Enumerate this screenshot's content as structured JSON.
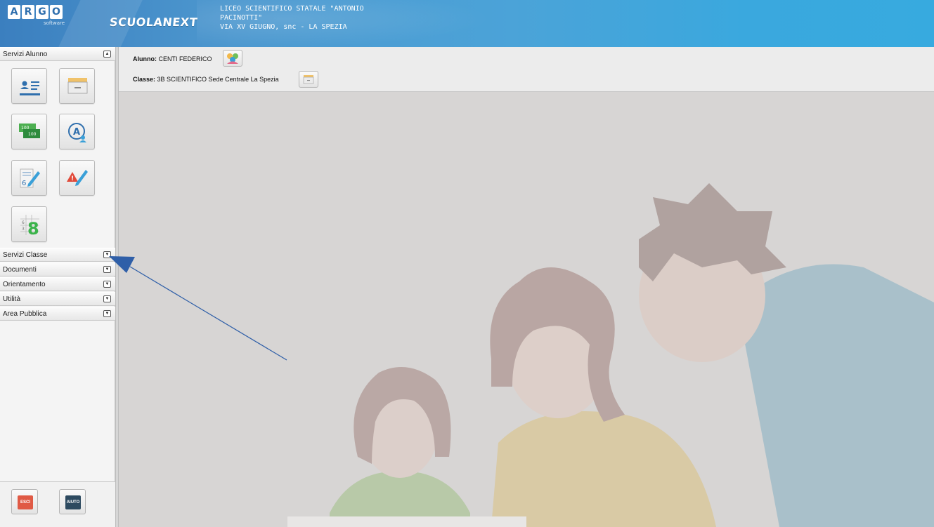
{
  "header": {
    "logo_letters": [
      "A",
      "R",
      "G",
      "O"
    ],
    "logo_sub": "software",
    "brand": "SCUOLANEXT",
    "school_line1": "LICEO SCIENTIFICO STATALE \"ANTONIO",
    "school_line2": "PACINOTTI\"",
    "school_line3": "VIA XV GIUGNO, snc - LA SPEZIA"
  },
  "sidebar": {
    "sections": [
      {
        "label": "Servizi Alunno",
        "state": "expanded"
      },
      {
        "label": "Servizi Classe",
        "state": "collapsed"
      },
      {
        "label": "Documenti",
        "state": "collapsed"
      },
      {
        "label": "Orientamento",
        "state": "collapsed"
      },
      {
        "label": "Utilità",
        "state": "collapsed"
      },
      {
        "label": "Area Pubblica",
        "state": "collapsed"
      }
    ],
    "student_icons": [
      {
        "icon": "student-card-icon"
      },
      {
        "icon": "archive-drawer-icon"
      },
      {
        "icon": "money-tax-icon"
      },
      {
        "icon": "absence-user-icon"
      },
      {
        "icon": "grade-pencil-icon"
      },
      {
        "icon": "alert-note-icon"
      },
      {
        "icon": "scoreboard-grade-icon"
      }
    ],
    "icon_texts": {
      "money1": "100",
      "money2": "100",
      "absence": "A",
      "grade": "6",
      "alert": "!",
      "score": "8",
      "score_small1": "6",
      "score_small2": "3"
    },
    "bottom": {
      "exit_label": "ESCI",
      "help_label": "AIUTO"
    }
  },
  "infobar": {
    "student_label": "Alunno:",
    "student_name": "CENTI FEDERICO",
    "class_label": "Classe:",
    "class_name": "3B SCIENTIFICO Sede Centrale La Spezia"
  },
  "colors": {
    "header_blue": "#3b86c7",
    "exit_red": "#e05a45",
    "help_navy": "#2d4a60",
    "arrow_blue": "#2f5fa8"
  }
}
